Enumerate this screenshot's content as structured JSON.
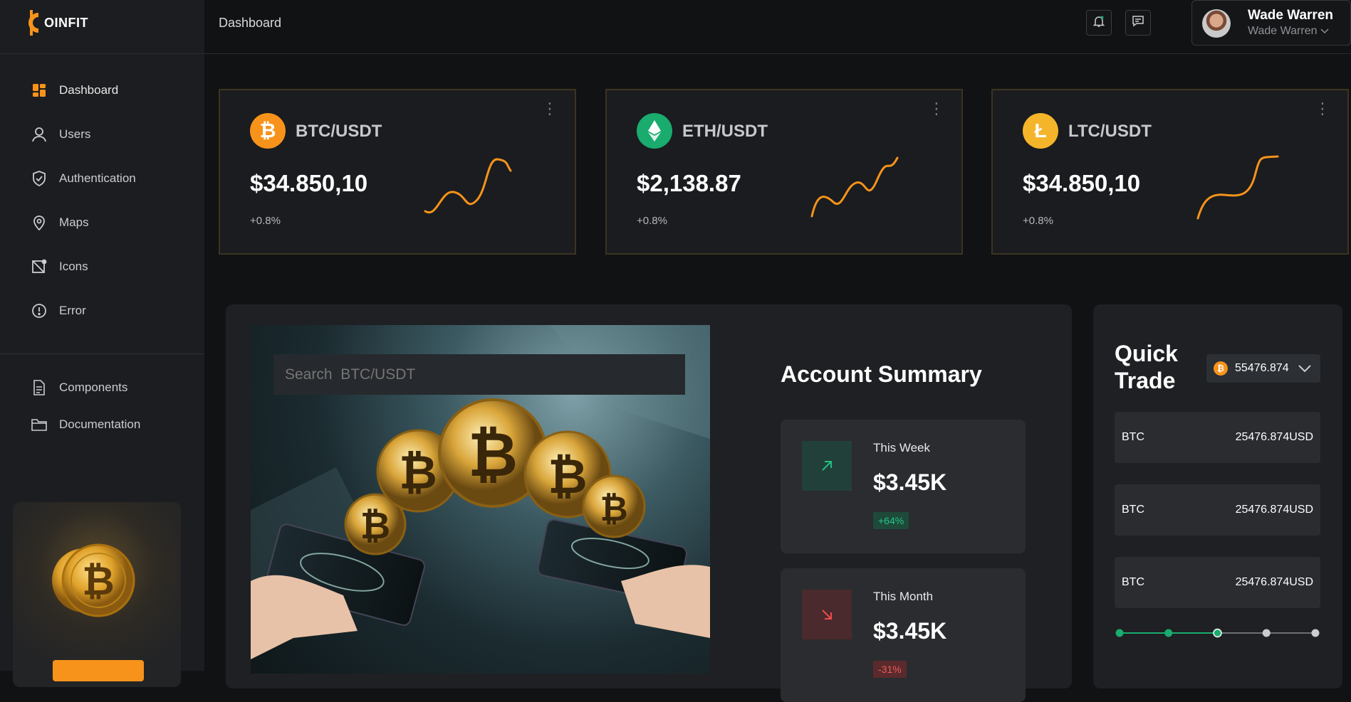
{
  "brand": {
    "name": "OINFIT",
    "accent": "#f7931a"
  },
  "header": {
    "title": "Dashboard",
    "user_name": "Wade Warren",
    "user_sub": "Wade Warren"
  },
  "sidebar": {
    "items": [
      {
        "label": "Dashboard",
        "icon": "dashboard-icon"
      },
      {
        "label": "Users",
        "icon": "user-icon"
      },
      {
        "label": "Authentication",
        "icon": "shield-check-icon"
      },
      {
        "label": "Maps",
        "icon": "map-pin-icon"
      },
      {
        "label": "Icons",
        "icon": "icons-icon"
      },
      {
        "label": "Error",
        "icon": "alert-circle-icon"
      }
    ],
    "secondary": [
      {
        "label": "Components",
        "icon": "document-icon"
      },
      {
        "label": "Documentation",
        "icon": "folder-icon"
      }
    ]
  },
  "tickers": [
    {
      "pair": "BTC/USDT",
      "price": "$34.850,10",
      "change": "+0.8%",
      "coin_color": "#f7931a",
      "symbol": "₿"
    },
    {
      "pair": "ETH/USDT",
      "price": "$2,138.87",
      "change": "+0.8%",
      "coin_color": "#1aab6e",
      "symbol": "Ξ"
    },
    {
      "pair": "LTC/USDT",
      "price": "$34.850,10",
      "change": "+0.8%",
      "coin_color": "#f5b52a",
      "symbol": "Ł"
    }
  ],
  "search": {
    "placeholder": "Search  BTC/USDT"
  },
  "account_summary": {
    "title": "Account Summary",
    "week": {
      "label": "This Week",
      "value": "$3.45K",
      "pct": "+64%"
    },
    "month": {
      "label": "This Month",
      "value": "$3.45K",
      "pct": "-31%"
    }
  },
  "quick_trade": {
    "title": "Quick Trade",
    "selected": "55476.874",
    "rows": [
      {
        "coin": "BTC",
        "amount": "25476.874USD"
      },
      {
        "coin": "BTC",
        "amount": "25476.874USD"
      },
      {
        "coin": "BTC",
        "amount": "25476.874USD"
      }
    ],
    "progress_steps_total": 5,
    "progress_steps_done": 3
  }
}
